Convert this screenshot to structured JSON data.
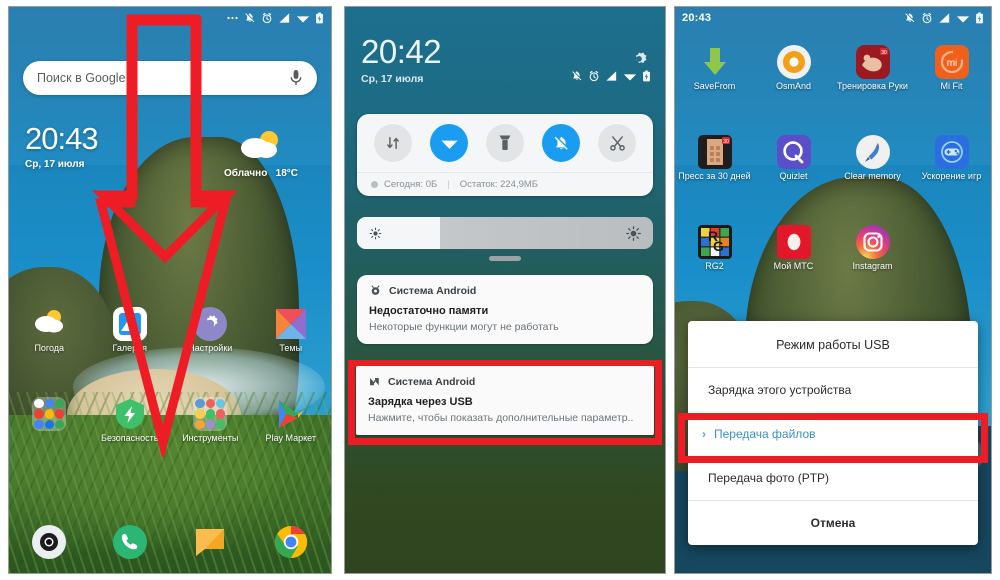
{
  "panel1": {
    "name": "home-screen",
    "statusbar": {
      "time": "",
      "icons": [
        "more-dots-icon",
        "bell-off-icon",
        "alarm-clock-icon",
        "signal-icon",
        "wifi-icon",
        "battery-charging-icon"
      ]
    },
    "search": {
      "placeholder": "Поиск в Google",
      "mic": "microphone-icon"
    },
    "clock": {
      "time": "20:43",
      "date": "Ср, 17 июля"
    },
    "weather": {
      "condition": "Облачно",
      "temperature": "18°C",
      "icon": "partly-cloudy-icon"
    },
    "apps_row1": [
      {
        "label": "Погода",
        "icon": "weather-app-icon"
      },
      {
        "label": "Галерея",
        "icon": "gallery-icon"
      },
      {
        "label": "Настройки",
        "icon": "settings-icon"
      },
      {
        "label": "Темы",
        "icon": "themes-icon"
      }
    ],
    "apps_row2": [
      {
        "label": "",
        "icon": "google-folder-icon"
      },
      {
        "label": "Безопасность",
        "icon": "security-icon"
      },
      {
        "label": "Инструменты",
        "icon": "tools-folder-icon"
      },
      {
        "label": "Play Маркет",
        "icon": "play-store-icon"
      }
    ],
    "dock": [
      {
        "label": "",
        "icon": "camera-icon"
      },
      {
        "label": "",
        "icon": "phone-icon"
      },
      {
        "label": "",
        "icon": "messages-icon"
      },
      {
        "label": "",
        "icon": "chrome-icon"
      }
    ],
    "annotation": {
      "type": "down-arrow",
      "color": "#ee1c25"
    }
  },
  "panel2": {
    "name": "notification-shade",
    "header": {
      "time": "20:42",
      "date": "Ср, 17 июля",
      "gear": "settings-gear-icon"
    },
    "statusbar": {
      "icons": [
        "bell-off-icon",
        "alarm-clock-icon",
        "signal-icon",
        "wifi-icon",
        "battery-charging-icon"
      ]
    },
    "quick_settings": {
      "tiles": [
        {
          "name": "mobile-data-toggle",
          "icon": "data-transfer-icon",
          "active": false
        },
        {
          "name": "wifi-toggle",
          "icon": "wifi-icon",
          "active": true
        },
        {
          "name": "flashlight-toggle",
          "icon": "flashlight-icon",
          "active": false
        },
        {
          "name": "silent-toggle",
          "icon": "bell-off-icon",
          "active": true
        },
        {
          "name": "screenshot-toggle",
          "icon": "scissors-icon",
          "active": false
        }
      ],
      "usage_today_label": "Сегодня: 0Б",
      "usage_separator": "|",
      "usage_remaining_label": "Остаток: 224,9МБ"
    },
    "brightness": {
      "level_percent": 28,
      "low_icon": "brightness-low-icon",
      "high_icon": "brightness-high-icon"
    },
    "notifications": [
      {
        "app": "Система Android",
        "app_icon": "android-system-icon",
        "title": "Недостаточно памяти",
        "body": "Некоторые функции могут не работать",
        "highlighted": false
      },
      {
        "app": "Система Android",
        "app_icon": "android-n-icon",
        "title": "Зарядка через USB",
        "body": "Нажмите, чтобы показать дополнительные параметр..",
        "highlighted": true
      }
    ],
    "annotation": {
      "type": "highlight-box",
      "color": "#ee1c25"
    }
  },
  "panel3": {
    "name": "app-drawer-with-usb-dialog",
    "statusbar": {
      "time": "20:43",
      "icons": [
        "bell-off-icon",
        "alarm-clock-icon",
        "signal-icon",
        "wifi-icon",
        "battery-charging-icon"
      ]
    },
    "apps_row1": [
      {
        "label": "SaveFrom",
        "icon": "savefrom-icon"
      },
      {
        "label": "OsmAnd",
        "icon": "osmand-icon"
      },
      {
        "label": "Тренировка Руки",
        "icon": "arm-workout-icon"
      },
      {
        "label": "Mi Fit",
        "icon": "mi-fit-icon"
      }
    ],
    "apps_row2": [
      {
        "label": "Пресс за 30 дней",
        "icon": "abs-workout-icon"
      },
      {
        "label": "Quizlet",
        "icon": "quizlet-icon"
      },
      {
        "label": "Clear memory",
        "icon": "clear-memory-icon"
      },
      {
        "label": "Ускорение игр",
        "icon": "game-turbo-icon"
      }
    ],
    "apps_row3": [
      {
        "label": "RG2",
        "icon": "rubiks-cube-icon"
      },
      {
        "label": "Мой МТС",
        "icon": "mts-icon"
      },
      {
        "label": "Instagram",
        "icon": "instagram-icon"
      },
      {
        "label": "",
        "icon": ""
      }
    ],
    "dialog": {
      "title": "Режим работы USB",
      "options": [
        {
          "label": "Зарядка этого устройства",
          "selected": false
        },
        {
          "label": "Передача файлов",
          "selected": true
        },
        {
          "label": "Передача фото (PTP)",
          "selected": false
        }
      ],
      "cancel_label": "Отмена"
    },
    "annotation": {
      "type": "highlight-box",
      "color": "#ee1c25"
    }
  }
}
